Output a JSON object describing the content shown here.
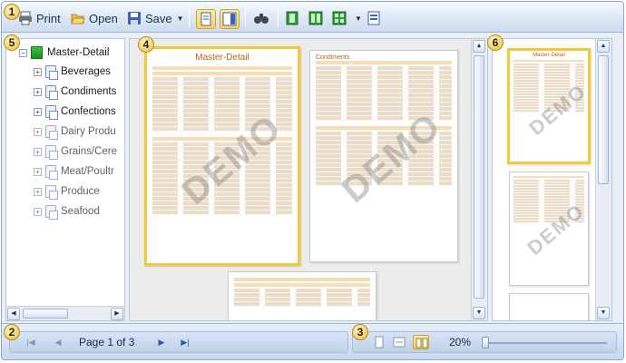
{
  "toolbar": {
    "print_label": "Print",
    "open_label": "Open",
    "save_label": "Save"
  },
  "badges": [
    "1",
    "2",
    "3",
    "4",
    "5",
    "6"
  ],
  "tree": {
    "root": "Master-Detail",
    "items": [
      "Beverages",
      "Condiments",
      "Confections",
      "Dairy Produ",
      "Grains/Cere",
      "Meat/Poultr",
      "Produce",
      "Seafood"
    ]
  },
  "preview": {
    "page1_title": "Master-Detail",
    "page2_title": "Condiments",
    "watermark": "DEMO"
  },
  "thumbnails": {
    "thumb1_title": "Master-Detail",
    "watermark": "DEMO"
  },
  "statusbar": {
    "page_label": "Page 1 of 3",
    "zoom_label": "20%"
  },
  "colors": {
    "accent": "#f3c93b",
    "toolbar_blue": "#cfdcef",
    "report_band": "#f8dcb4"
  }
}
